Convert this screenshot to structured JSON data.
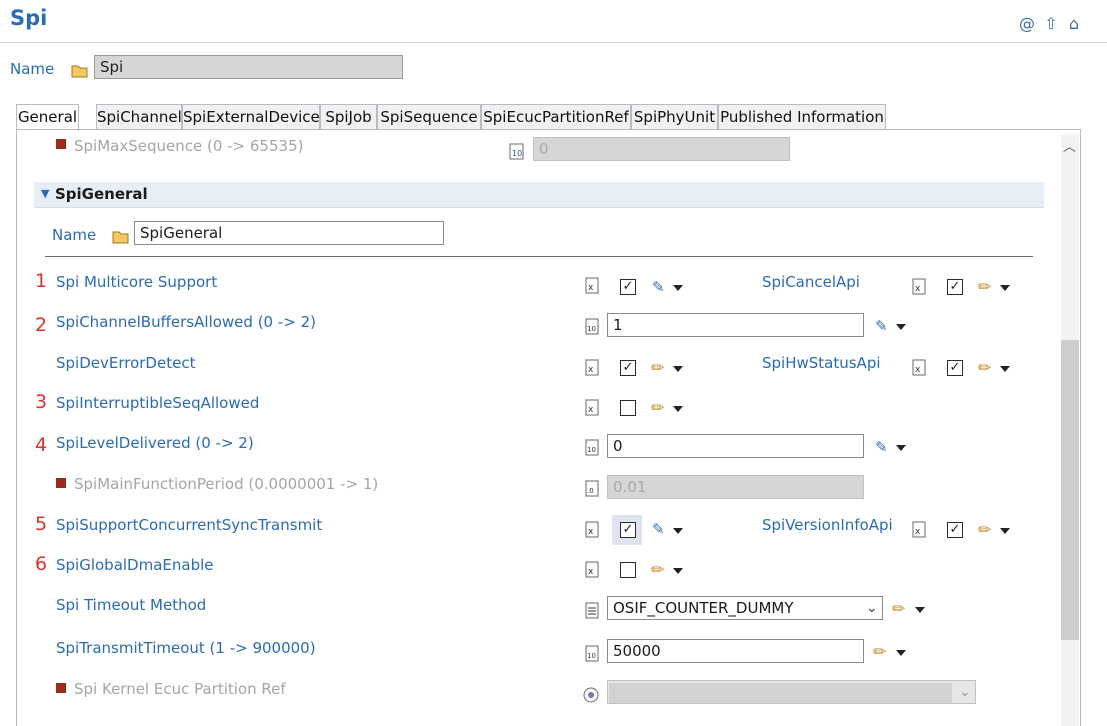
{
  "header": {
    "title": "Spi",
    "icons": [
      "at-icon",
      "up-arrow-icon",
      "home-icon"
    ]
  },
  "name_row": {
    "label": "Name",
    "value": "Spi"
  },
  "tabs": [
    {
      "label": "General",
      "active": true
    },
    {
      "label": "SpiChannel"
    },
    {
      "label": "SpiExternalDevice"
    },
    {
      "label": "SpiJob"
    },
    {
      "label": "SpiSequence"
    },
    {
      "label": "SpiEcucPartitionRef"
    },
    {
      "label": "SpiPhyUnit"
    },
    {
      "label": "Published Information"
    }
  ],
  "top_param": {
    "label": "SpiMaxSequence (0 -> 65535)",
    "value": "0"
  },
  "section": {
    "title": "SpiGeneral",
    "name_label": "Name",
    "name_value": "SpiGeneral"
  },
  "markers": [
    "1",
    "2",
    "3",
    "4",
    "5",
    "6"
  ],
  "params": {
    "multicore": {
      "label": "Spi Multicore Support",
      "checked": true
    },
    "cancel_api": {
      "label": "SpiCancelApi",
      "checked": true
    },
    "channel_buffers": {
      "label": "SpiChannelBuffersAllowed (0 -> 2)",
      "value": "1"
    },
    "dev_error": {
      "label": "SpiDevErrorDetect",
      "checked": true
    },
    "hw_status": {
      "label": "SpiHwStatusApi",
      "checked": true
    },
    "interruptible": {
      "label": "SpiInterruptibleSeqAllowed",
      "checked": false
    },
    "level_delivered": {
      "label": "SpiLevelDelivered (0 -> 2)",
      "value": "0"
    },
    "main_function_period": {
      "label": "SpiMainFunctionPeriod (0.0000001 -> 1)",
      "value": "0.01"
    },
    "concurrent_sync": {
      "label": "SpiSupportConcurrentSyncTransmit",
      "checked": true
    },
    "version_info": {
      "label": "SpiVersionInfoApi",
      "checked": true
    },
    "global_dma": {
      "label": "SpiGlobalDmaEnable",
      "checked": false
    },
    "timeout_method": {
      "label": "Spi Timeout Method",
      "value": "OSIF_COUNTER_DUMMY"
    },
    "transmit_timeout": {
      "label": "SpiTransmitTimeout (1 -> 900000)",
      "value": "50000"
    },
    "kernel_partition": {
      "label": "Spi Kernel Ecuc Partition Ref",
      "value": ""
    }
  },
  "colors": {
    "label_blue": "#2a6bb3",
    "marker_red": "#e03030",
    "disabled_gray": "#a5a5a5",
    "section_bg": "#e8eef6"
  }
}
